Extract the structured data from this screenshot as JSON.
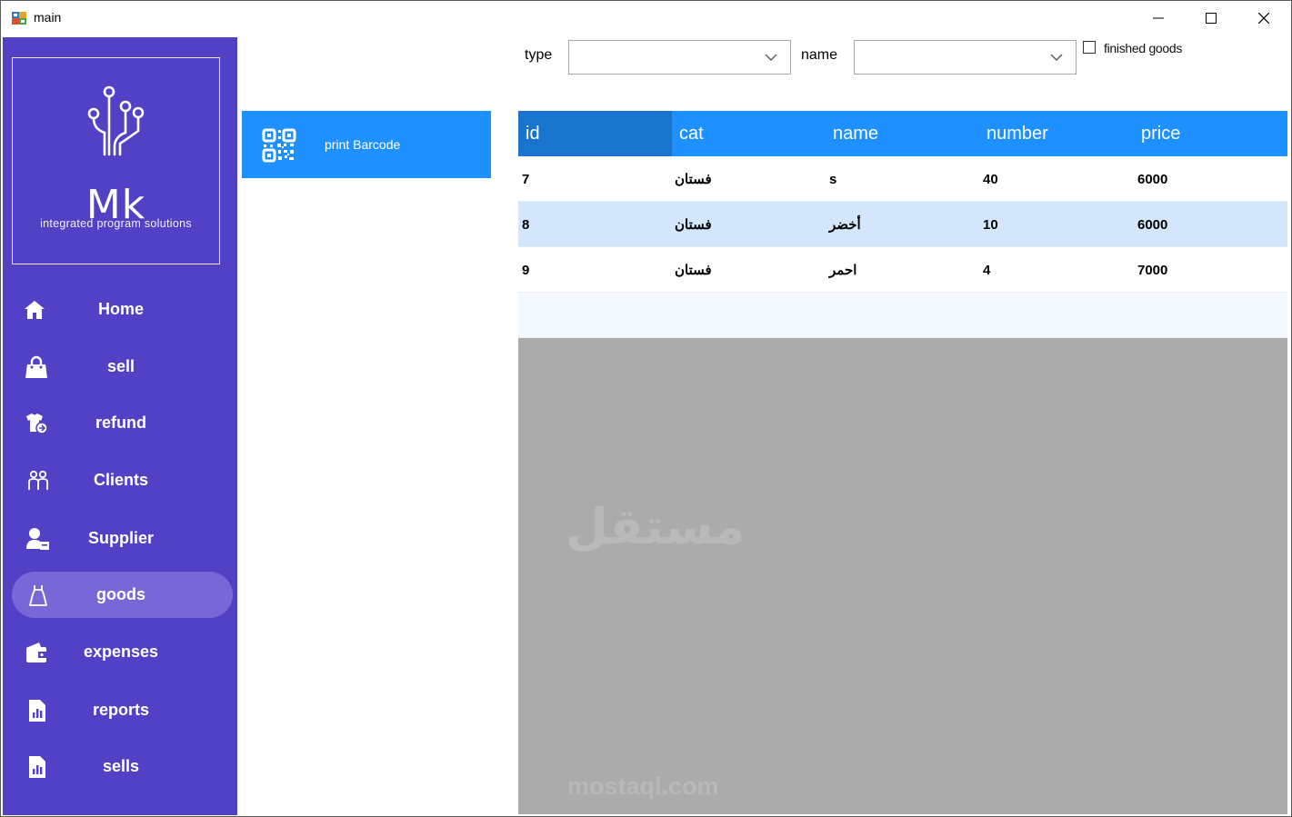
{
  "window": {
    "title": "main"
  },
  "logo": {
    "brand": "Mk",
    "tagline": "integrated program solutions"
  },
  "sidebar": {
    "items": [
      {
        "label": "Home",
        "icon": "home-icon",
        "active": false
      },
      {
        "label": "sell",
        "icon": "shopping-bag-icon",
        "active": false
      },
      {
        "label": "refund",
        "icon": "refund-shirt-icon",
        "active": false
      },
      {
        "label": "Clients",
        "icon": "clients-icon",
        "active": false
      },
      {
        "label": "Supplier",
        "icon": "supplier-icon",
        "active": false
      },
      {
        "label": "goods",
        "icon": "dress-icon",
        "active": true
      },
      {
        "label": "expenses",
        "icon": "wallet-icon",
        "active": false
      },
      {
        "label": "reports",
        "icon": "report-chart-icon",
        "active": false
      },
      {
        "label": "sells",
        "icon": "report-chart-icon",
        "active": false
      }
    ]
  },
  "filters": {
    "type_label": "type",
    "type_value": "",
    "name_label": "name",
    "name_value": "",
    "finished_goods_label": "finished goods",
    "finished_goods_checked": false
  },
  "actions": {
    "print_barcode_label": "print Barcode",
    "print_barcode_icon": "qr-code-icon"
  },
  "grid": {
    "columns": [
      "id",
      "cat",
      "name",
      "number",
      "price"
    ],
    "rows": [
      {
        "id": "7",
        "cat": "فستان",
        "name": "s",
        "number": "40",
        "price": "6000"
      },
      {
        "id": "8",
        "cat": "فستان",
        "name": "أخضر",
        "number": "10",
        "price": "6000"
      },
      {
        "id": "9",
        "cat": "فستان",
        "name": "احمر",
        "number": "4",
        "price": "7000"
      }
    ]
  },
  "watermark": {
    "arabic": "مستقل",
    "latin": "mostaql.com"
  },
  "colors": {
    "sidebar": "#5142c5",
    "sidebar_active": "#7868d7",
    "accent": "#1e90ff",
    "header_selected": "#1874cd",
    "row_alt": "#d3e6fb",
    "grid_background": "#ababab"
  }
}
